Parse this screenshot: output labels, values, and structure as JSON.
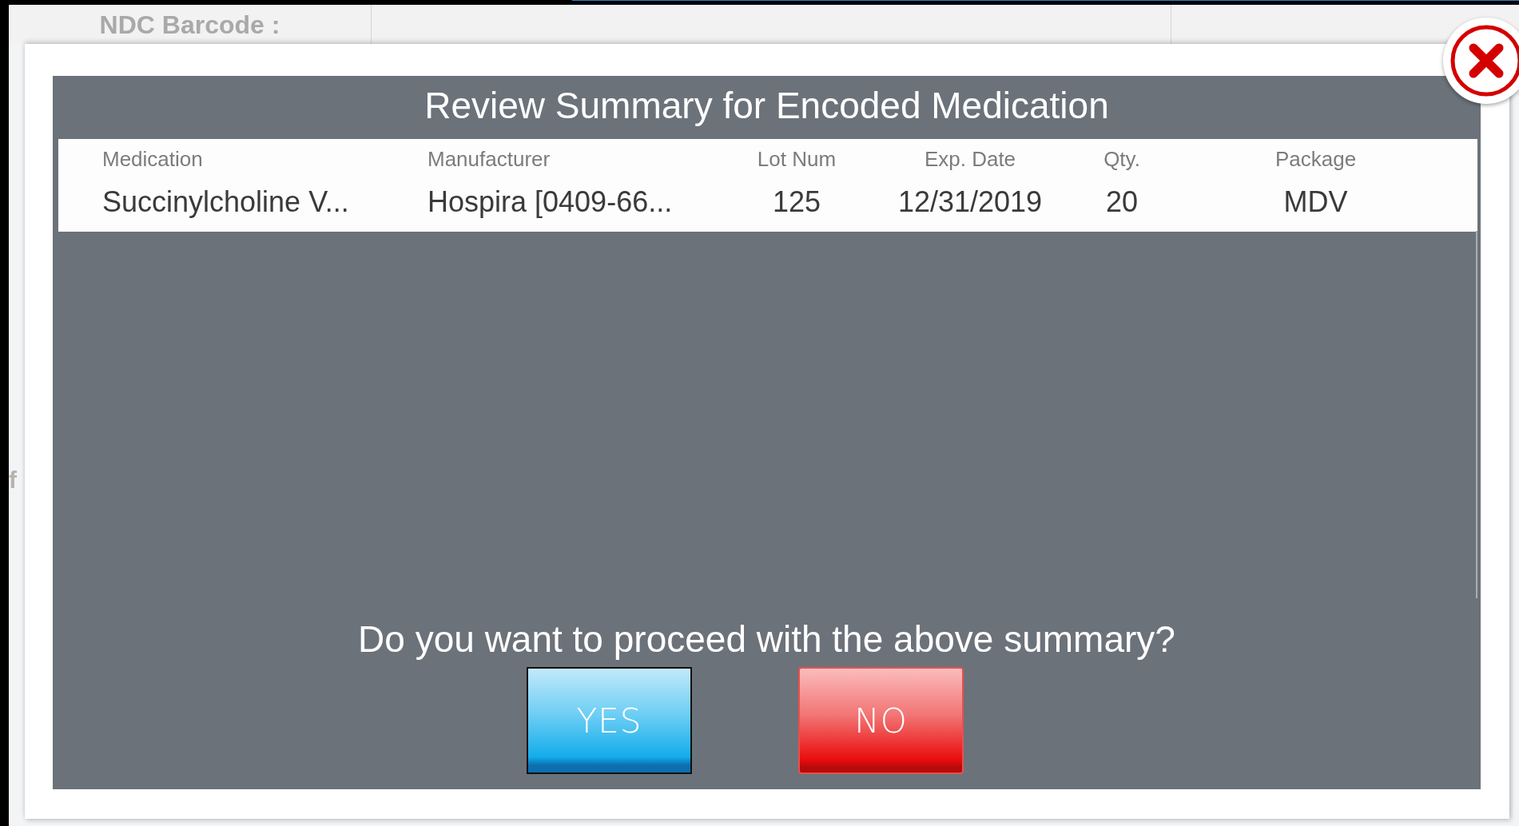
{
  "background": {
    "field_label": "NDC Barcode :",
    "fragment": "f"
  },
  "dialog": {
    "title": "Review Summary for Encoded Medication",
    "columns": [
      "Medication",
      "Manufacturer",
      "Lot Num",
      "Exp. Date",
      "Qty.",
      "Package"
    ],
    "rows": [
      {
        "cells": [
          "Succinylcholine V...",
          "Hospira [0409-66...",
          "125",
          "12/31/2019",
          "20",
          "MDV"
        ]
      }
    ],
    "question": "Do you want to proceed with the above summary?",
    "buttons": [
      {
        "label": "YES",
        "kind": "confirm",
        "focused": true
      },
      {
        "label": "NO",
        "kind": "cancel",
        "focused": false
      }
    ]
  }
}
